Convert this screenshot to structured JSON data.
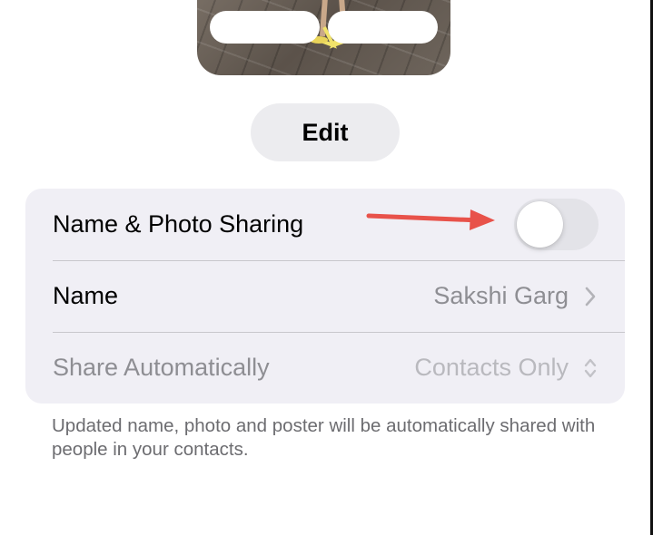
{
  "edit_button": {
    "label": "Edit"
  },
  "settings": {
    "rows": [
      {
        "label": "Name & Photo Sharing",
        "toggle_on": false
      },
      {
        "label": "Name",
        "value": "Sakshi Garg",
        "accessory": "chevron-right-icon"
      },
      {
        "label": "Share Automatically",
        "value": "Contacts Only",
        "accessory": "up-down-chevron-icon",
        "disabled": true
      }
    ]
  },
  "footer_note": "Updated name, photo and poster will be automatically shared with people in your contacts.",
  "colors": {
    "card_background": "#f0eff5",
    "annotation_arrow": "#e8524a",
    "secondary_text": "#8e8e93",
    "toggle_off": "#e3e3e8"
  }
}
